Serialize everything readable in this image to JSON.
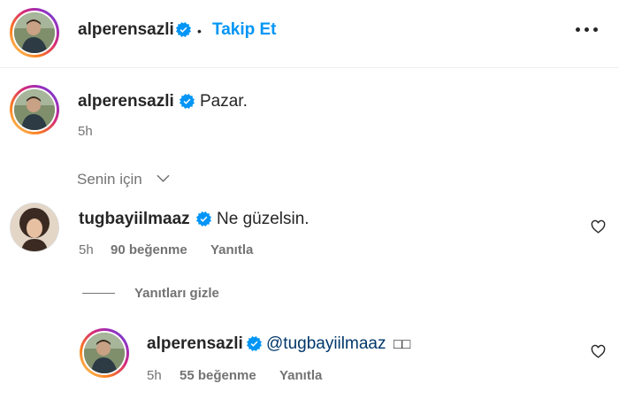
{
  "header": {
    "username": "alperensazli",
    "separator": "•",
    "follow_label": "Takip Et"
  },
  "caption": {
    "username": "alperensazli",
    "text": "Pazar.",
    "time": "5h"
  },
  "filter": {
    "label": "Senin için",
    "chevron": "chevron-down-icon"
  },
  "comment": {
    "username": "tugbayiilmaaz",
    "text": "Ne güzelsin.",
    "time": "5h",
    "likes": "90 beğenme",
    "reply_label": "Yanıtla"
  },
  "replies_toggle": {
    "label": "Yanıtları gizle"
  },
  "reply": {
    "username": "alperensazli",
    "mention": "@tugbayiilmaaz",
    "extra": "□□",
    "time": "5h",
    "likes": "55 beğenme",
    "reply_label": "Yanıtla"
  },
  "colors": {
    "accent": "#0095f6",
    "verified": "#0095f6",
    "text": "#262626",
    "muted": "#737373"
  }
}
